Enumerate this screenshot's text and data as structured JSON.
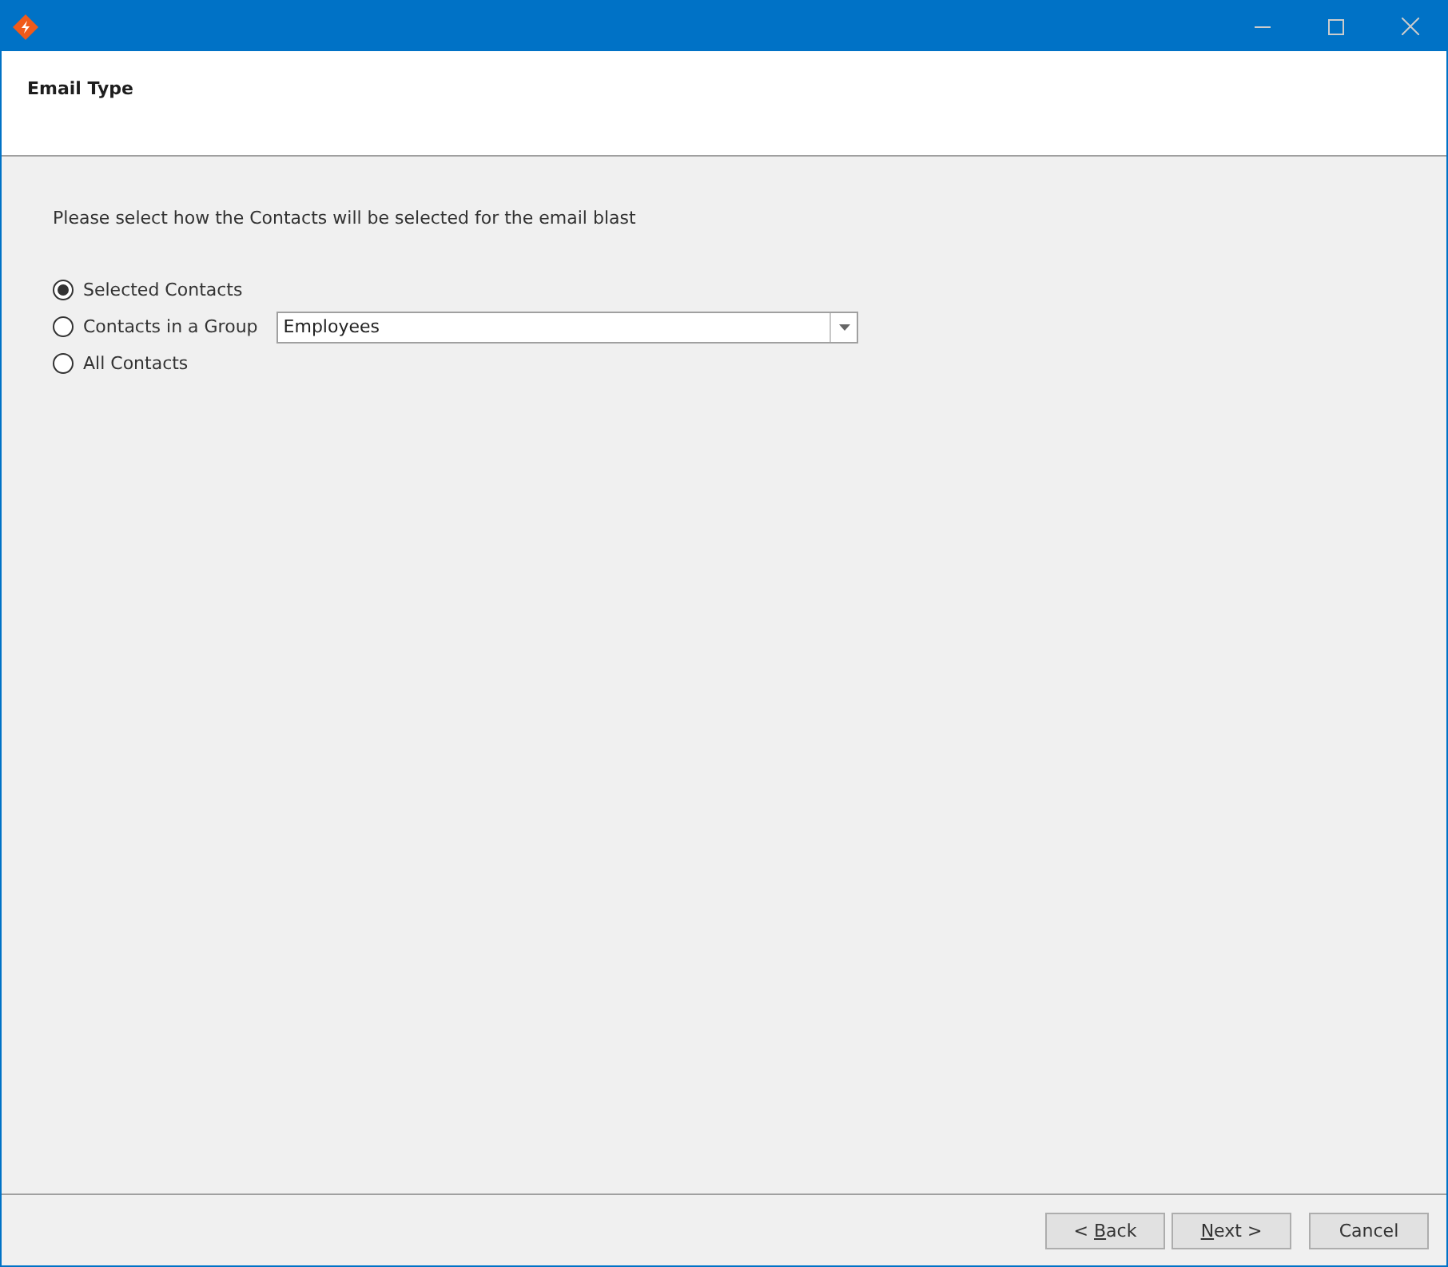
{
  "header": {
    "title": "Email Type"
  },
  "prompt": "Please select how the Contacts will be selected for the email blast",
  "options": [
    {
      "label": "Selected Contacts",
      "selected": true
    },
    {
      "label": "Contacts in a Group",
      "selected": false,
      "dropdown": {
        "value": "Employees"
      }
    },
    {
      "label": "All Contacts",
      "selected": false
    }
  ],
  "buttons": [
    {
      "before": "< ",
      "key": "B",
      "after": "ack"
    },
    {
      "key": "N",
      "after": "ext >"
    },
    {
      "before": "Cancel"
    }
  ]
}
